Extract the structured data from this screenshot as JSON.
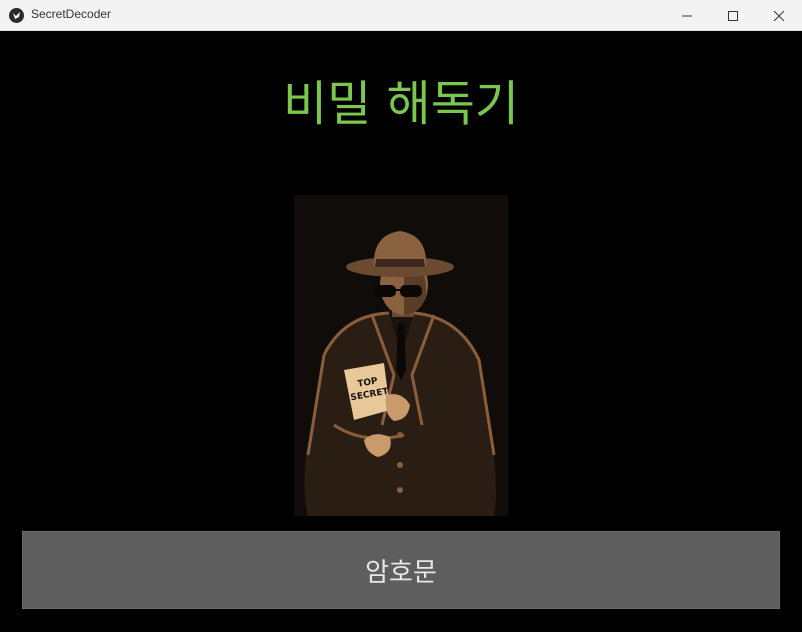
{
  "window": {
    "title": "SecretDecoder",
    "icon": "kivy-app-icon",
    "controls": [
      "minimize-icon",
      "maximize-icon",
      "close-icon"
    ]
  },
  "main": {
    "heading": "비밀 해독기",
    "heading_color": "#7ac64f",
    "illustration": {
      "icon": "spy-detective-image",
      "document_label_line1": "TOP",
      "document_label_line2": "SECRET"
    },
    "action_button": {
      "label": "암호문",
      "color": "#5e5e5e"
    }
  }
}
